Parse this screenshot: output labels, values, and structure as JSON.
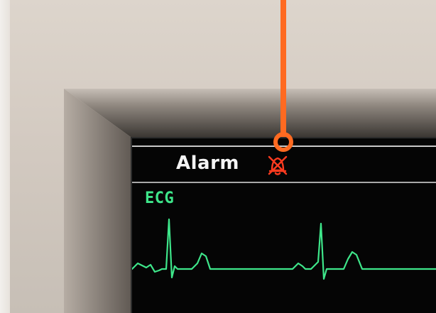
{
  "monitor": {
    "alarm_label": "Alarm",
    "alarm_icon": "alarm-muted-icon",
    "ecg_label": "ECG"
  },
  "colors": {
    "alarm_text": "#f4f4f4",
    "alarm_icon": "#ff3b1f",
    "ecg_trace": "#3ee68a",
    "callout": "#ff6a21",
    "screen_bg": "#050505"
  }
}
